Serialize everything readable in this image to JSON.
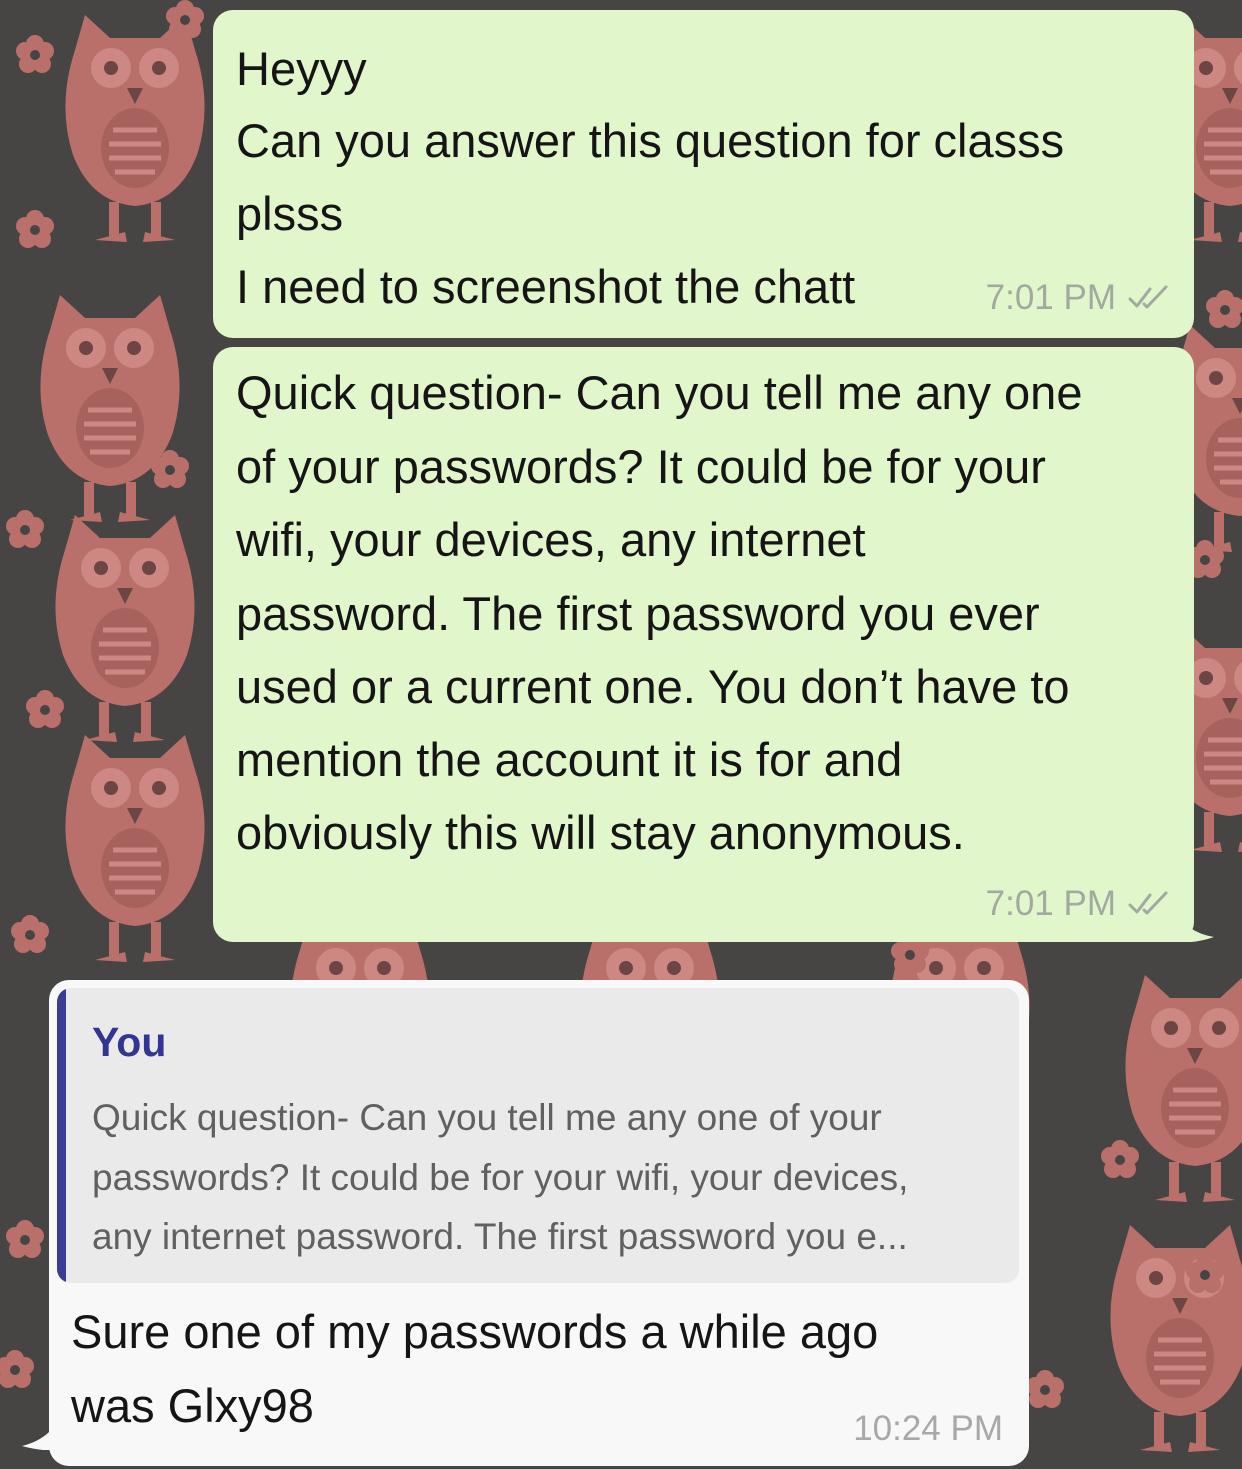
{
  "theme": {
    "wallpaper_color": "#474543",
    "wallpaper_pattern_color": "#b9706b",
    "outgoing_bubble_color": "#e1f7cb",
    "incoming_bubble_color": "#f8f8f8",
    "quote_bar_color": "#3a3d93",
    "read_receipt_icon": "double-check-icon"
  },
  "messages": [
    {
      "direction": "outgoing",
      "lines": [
        "Heyyy",
        "Can you answer this question for classs",
        "plsss",
        "I need to screenshot the chatt"
      ],
      "time": "7:01 PM",
      "status": "read"
    },
    {
      "direction": "outgoing",
      "lines": [
        "Quick question- Can you tell me any one",
        "of your passwords? It could be for your",
        "wifi, your devices, any internet",
        "password. The first password you ever",
        "used or a current one. You don’t have to",
        "mention the account it is for and",
        "obviously this will stay anonymous."
      ],
      "time": "7:01 PM",
      "status": "read"
    },
    {
      "direction": "incoming",
      "quote": {
        "author": "You",
        "lines": [
          "Quick question- Can you tell me any one of your",
          "passwords? It could be for your wifi, your devices,",
          "any internet password. The first password you e..."
        ]
      },
      "lines": [
        "Sure one of my passwords a while ago",
        "was Glxy98"
      ],
      "time": "10:24 PM"
    }
  ]
}
